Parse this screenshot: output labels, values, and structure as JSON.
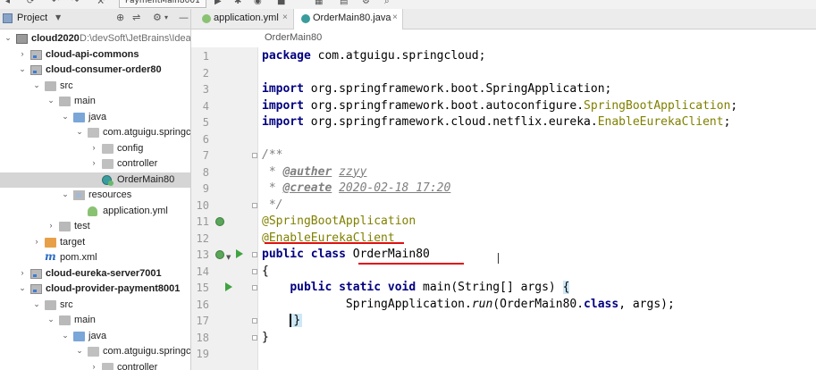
{
  "toolbar": {
    "run_config": "PaymentMain8001"
  },
  "project_panel": {
    "title": "Project"
  },
  "tree": [
    {
      "label": "cloud2020",
      "path": "D:\\devSoft\\JetBrains\\IdeaP",
      "depth": 0,
      "expanded": true,
      "icon": "project-icon",
      "bold": true
    },
    {
      "label": "cloud-api-commons",
      "depth": 1,
      "expanded": false,
      "icon": "module-icon",
      "bold": true
    },
    {
      "label": "cloud-consumer-order80",
      "depth": 1,
      "expanded": true,
      "icon": "module-icon",
      "bold": true
    },
    {
      "label": "src",
      "depth": 2,
      "expanded": true,
      "icon": "plain-folder-icon"
    },
    {
      "label": "main",
      "depth": 3,
      "expanded": true,
      "icon": "plain-folder-icon"
    },
    {
      "label": "java",
      "depth": 4,
      "expanded": true,
      "icon": "source-folder-icon"
    },
    {
      "label": "com.atguigu.springcl",
      "depth": 5,
      "expanded": true,
      "icon": "package-icon"
    },
    {
      "label": "config",
      "depth": 6,
      "expanded": false,
      "icon": "package-icon"
    },
    {
      "label": "controller",
      "depth": 6,
      "expanded": false,
      "icon": "package-icon"
    },
    {
      "label": "OrderMain80",
      "depth": 6,
      "icon": "spring-class-icon",
      "selected": true
    },
    {
      "label": "resources",
      "depth": 4,
      "expanded": true,
      "icon": "resources-folder-icon"
    },
    {
      "label": "application.yml",
      "depth": 5,
      "icon": "yml-file-icon"
    },
    {
      "label": "test",
      "depth": 3,
      "expanded": false,
      "icon": "plain-folder-icon"
    },
    {
      "label": "target",
      "depth": 2,
      "expanded": false,
      "icon": "orange-folder-icon"
    },
    {
      "label": "pom.xml",
      "depth": 2,
      "icon": "maven-icon"
    },
    {
      "label": "cloud-eureka-server7001",
      "depth": 1,
      "expanded": false,
      "icon": "module-icon",
      "bold": true
    },
    {
      "label": "cloud-provider-payment8001",
      "depth": 1,
      "expanded": true,
      "icon": "module-icon",
      "bold": true
    },
    {
      "label": "src",
      "depth": 2,
      "expanded": true,
      "icon": "plain-folder-icon"
    },
    {
      "label": "main",
      "depth": 3,
      "expanded": true,
      "icon": "plain-folder-icon"
    },
    {
      "label": "java",
      "depth": 4,
      "expanded": true,
      "icon": "source-folder-icon"
    },
    {
      "label": "com.atguigu.springcl",
      "depth": 5,
      "expanded": true,
      "icon": "package-icon"
    },
    {
      "label": "controller",
      "depth": 6,
      "expanded": false,
      "icon": "package-icon"
    }
  ],
  "tabs": [
    {
      "label": "application.yml",
      "active": false
    },
    {
      "label": "OrderMain80.java",
      "active": true
    }
  ],
  "breadcrumb": "OrderMain80",
  "line_numbers": [
    "1",
    "2",
    "3",
    "4",
    "5",
    "6",
    "7",
    "8",
    "9",
    "10",
    "11",
    "12",
    "13",
    "14",
    "15",
    "16",
    "17",
    "18",
    "19"
  ],
  "code": {
    "l1": {
      "kw": "package",
      "rest": " com.atguigu.springcloud;"
    },
    "l3": {
      "kw": "import",
      "rest": " org.springframework.boot.SpringApplication;"
    },
    "l4": {
      "kw": "import",
      "rest": " org.springframework.boot.autoconfigure.",
      "unused": "SpringBootApplication",
      "end": ";"
    },
    "l5": {
      "kw": "import",
      "rest": " org.springframework.cloud.netflix.eureka.",
      "unused": "EnableEurekaClient",
      "end": ";"
    },
    "l7": "/**",
    "l8": {
      "star": " * ",
      "tag": "@auther",
      "sp": " ",
      "val": "zzyy"
    },
    "l9": {
      "star": " * ",
      "tag": "@create",
      "sp": " ",
      "val": "2020-02-18 17:20"
    },
    "l10": " */",
    "l11": "@SpringBootApplication",
    "l12": "@EnableEurekaClient",
    "l13": {
      "kw": "public class",
      "rest": " OrderMain80"
    },
    "l14": "{",
    "l15": {
      "indent": "    ",
      "kw": "public static void",
      "rest": " main(String[] args) ",
      "brace": "{"
    },
    "l16": {
      "indent": "            ",
      "cls": "SpringApplication.",
      "method": "run",
      "args": "(OrderMain80.",
      "kwcls": "class",
      "tail": ", args);"
    },
    "l17": {
      "indent": "    ",
      "brace": "}"
    },
    "l18": "}"
  }
}
